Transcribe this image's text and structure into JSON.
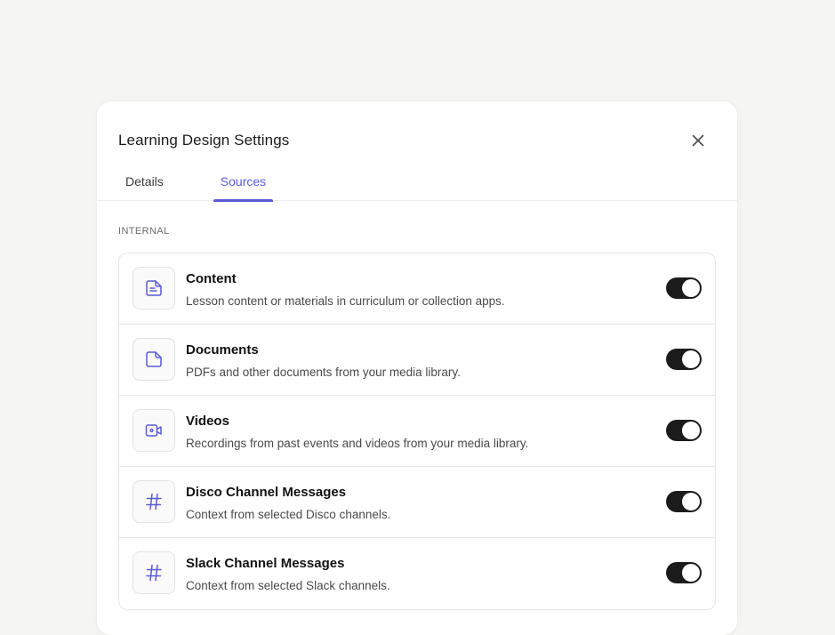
{
  "modal": {
    "title": "Learning Design Settings"
  },
  "tabs": [
    {
      "label": "Details",
      "active": false
    },
    {
      "label": "Sources",
      "active": true
    }
  ],
  "section": {
    "label": "INTERNAL"
  },
  "sources": [
    {
      "icon": "content-doc-icon",
      "title": "Content",
      "description": "Lesson content or materials in curriculum or collection apps.",
      "enabled": true
    },
    {
      "icon": "document-icon",
      "title": "Documents",
      "description": "PDFs and other documents from your media library.",
      "enabled": true
    },
    {
      "icon": "video-camera-icon",
      "title": "Videos",
      "description": "Recordings from past events and videos from your media library.",
      "enabled": true
    },
    {
      "icon": "hash-icon",
      "title": "Disco Channel Messages",
      "description": "Context from selected Disco channels.",
      "enabled": true
    },
    {
      "icon": "hash-icon",
      "title": "Slack Channel Messages",
      "description": "Context from selected Slack channels.",
      "enabled": true
    }
  ],
  "colors": {
    "accent": "#5b5bd6",
    "toggle_on": "#1b1b1b",
    "icon_stroke": "#5b5bd6",
    "background": "#f5f5f3"
  }
}
